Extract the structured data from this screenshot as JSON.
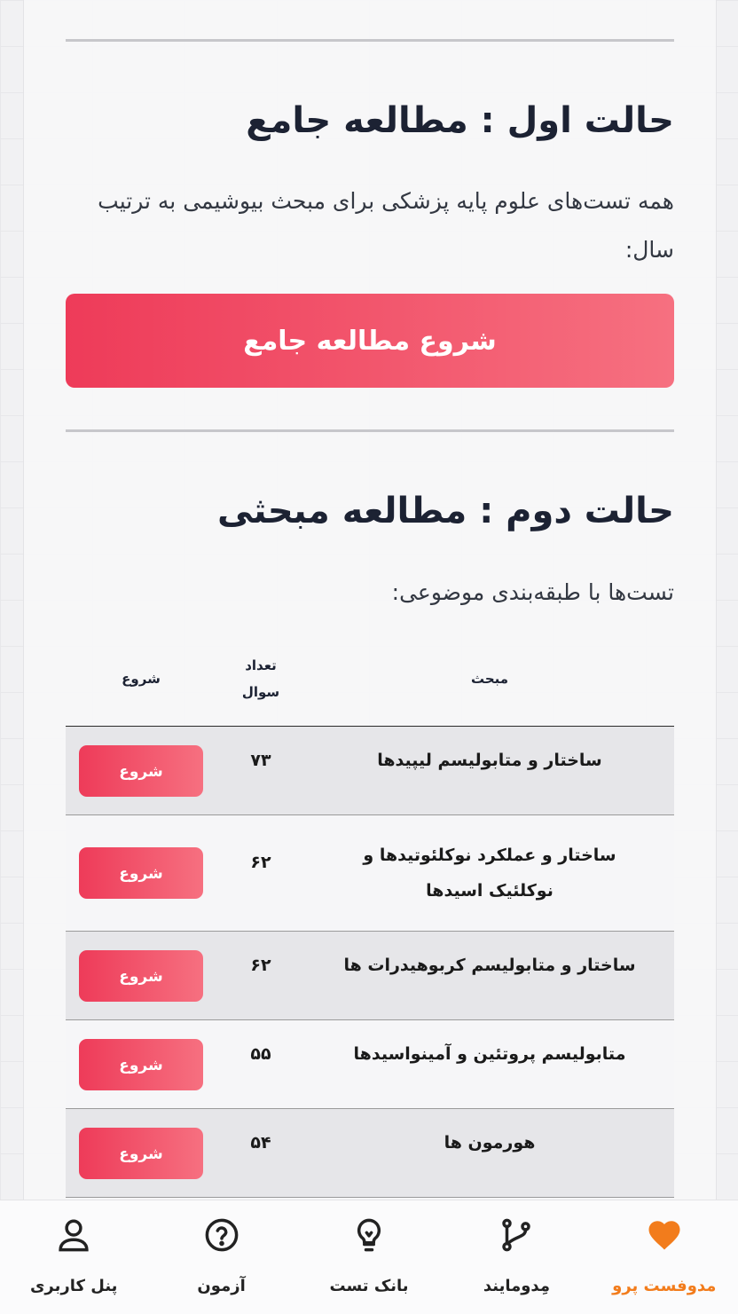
{
  "section1": {
    "title": "حالت اول : مطالعه جامع",
    "description": "همه تست‌های علوم پایه پزشکی برای مبحث بیوشیمی به ترتیب سال:",
    "button_label": "شروع مطالعه جامع"
  },
  "section2": {
    "title": "حالت دوم : مطالعه مبحثی",
    "description": "تست‌ها با طبقه‌بندی موضوعی:"
  },
  "table": {
    "headers": {
      "topic": "مبحث",
      "count": "تعداد سوال",
      "start": "شروع"
    },
    "rows": [
      {
        "topic": "ساختار و متابولیسم لیپیدها",
        "count": "۷۳",
        "button": "شروع"
      },
      {
        "topic": "ساختار و عملکرد نوکلئوتیدها و نوکلئیک اسیدها",
        "count": "۶۲",
        "button": "شروع"
      },
      {
        "topic": "ساختار و متابولیسم کربوهیدرات ها",
        "count": "۶۲",
        "button": "شروع"
      },
      {
        "topic": "متابولیسم پروتئین و آمینواسیدها",
        "count": "۵۵",
        "button": "شروع"
      },
      {
        "topic": "هورمون ها",
        "count": "۵۴",
        "button": "شروع"
      }
    ]
  },
  "bottom_nav": [
    {
      "label": "مدوفست پرو",
      "icon": "heart-icon",
      "active": true
    },
    {
      "label": "مِدومایند",
      "icon": "git-branch-icon",
      "active": false
    },
    {
      "label": "بانک تست",
      "icon": "lightbulb-icon",
      "active": false
    },
    {
      "label": "آزمون",
      "icon": "question-circle-icon",
      "active": false
    },
    {
      "label": "پنل کاربری",
      "icon": "user-icon",
      "active": false
    }
  ],
  "colors": {
    "accent_gradient_start": "#ee3b59",
    "accent_gradient_end": "#f67080",
    "active_nav": "#f27c1c"
  }
}
